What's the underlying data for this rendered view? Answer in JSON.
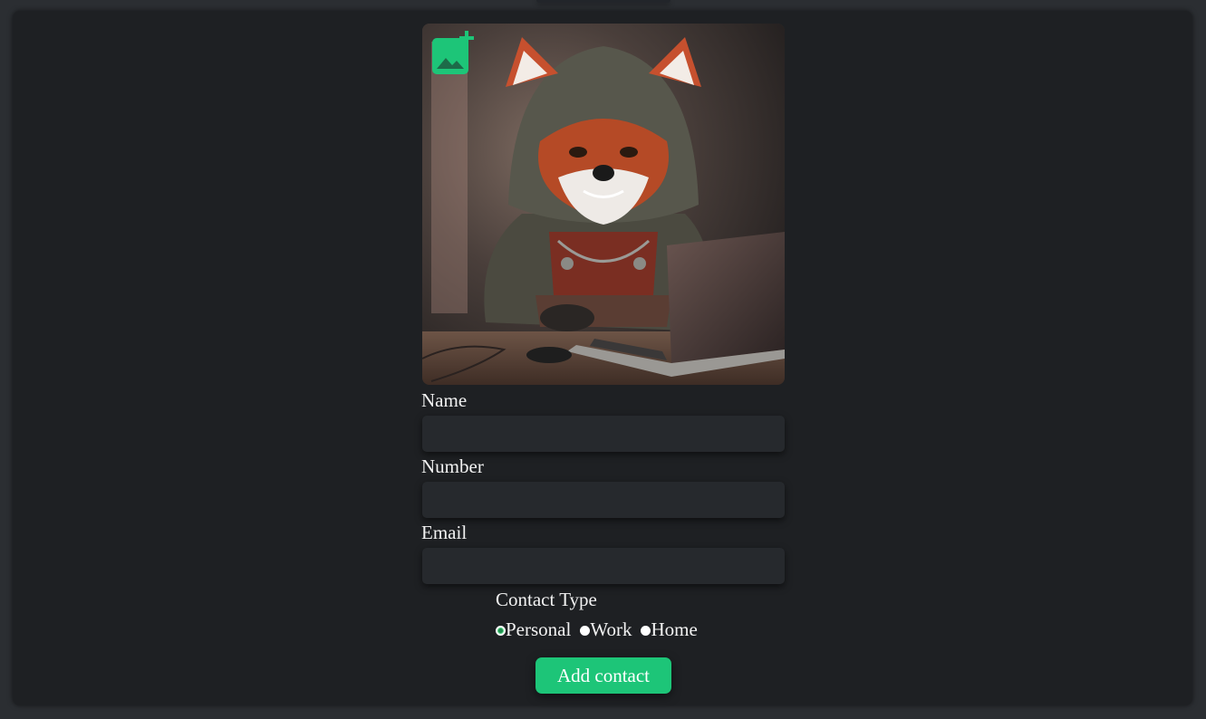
{
  "photo": {
    "alt": "Red fox in a hooded cloak using a laptop",
    "add_icon": "add-photo-icon",
    "accent": "#1dc578"
  },
  "form": {
    "name_label": "Name",
    "name_value": "",
    "number_label": "Number",
    "number_value": "",
    "email_label": "Email",
    "email_value": "",
    "contact_type_label": "Contact Type",
    "contact_types": [
      {
        "label": "Personal",
        "checked": true
      },
      {
        "label": "Work",
        "checked": false
      },
      {
        "label": "Home",
        "checked": false
      }
    ],
    "submit_label": "Add contact"
  },
  "colors": {
    "background": "#2b2e32",
    "panel": "#1e2023",
    "input": "#26292d",
    "button": "#1dc578"
  }
}
